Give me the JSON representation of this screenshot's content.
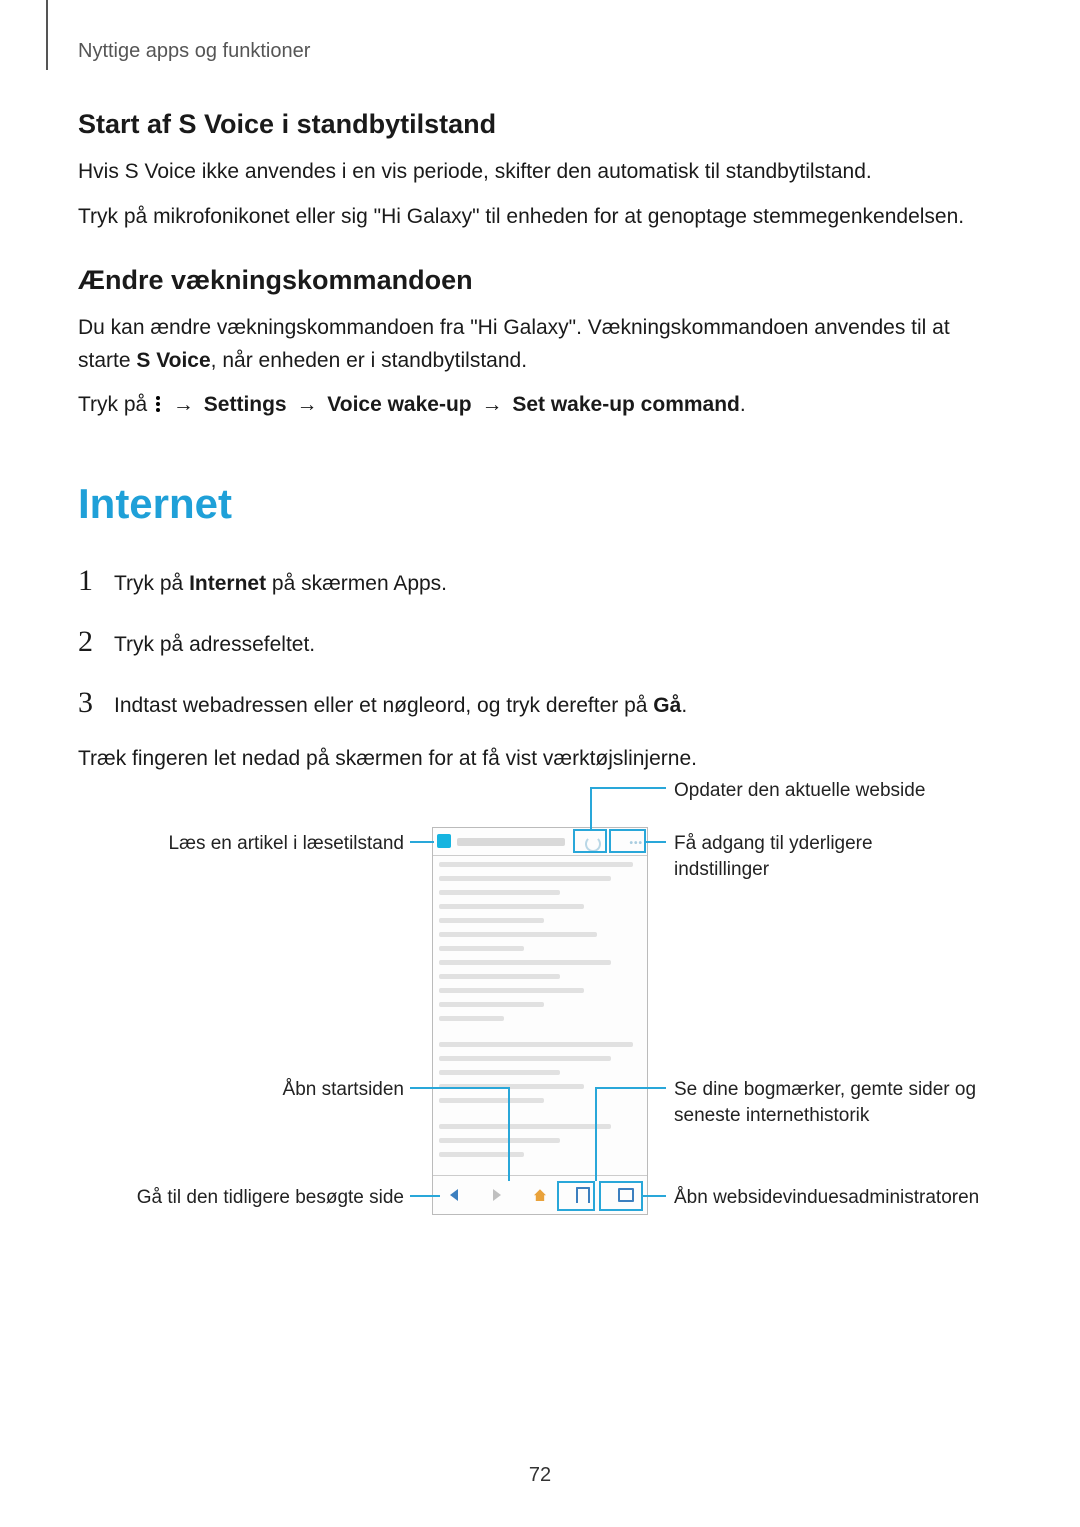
{
  "breadcrumb": "Nyttige apps og funktioner",
  "section_standby": {
    "title": "Start af S Voice i standbytilstand",
    "p1": "Hvis S Voice ikke anvendes i en vis periode, skifter den automatisk til standbytilstand.",
    "p2": "Tryk på mikrofonikonet eller sig \"Hi Galaxy\" til enheden for at genoptage stemmegenkendelsen."
  },
  "section_wake": {
    "title": "Ændre vækningskommandoen",
    "p1_a": "Du kan ændre vækningskommandoen fra \"Hi Galaxy\". Vækningskommandoen anvendes til at starte ",
    "p1_bold": "S Voice",
    "p1_b": ", når enheden er i standbytilstand.",
    "tap_prefix": "Tryk på ",
    "arrow": "→",
    "settings": "Settings",
    "voice_wakeup": "Voice wake-up",
    "set_cmd": "Set wake-up command",
    "period": "."
  },
  "internet": {
    "heading": "Internet",
    "steps": [
      {
        "num": "1",
        "pre": "Tryk på ",
        "bold": "Internet",
        "post": " på skærmen Apps."
      },
      {
        "num": "2",
        "pre": "Tryk på adressefeltet.",
        "bold": "",
        "post": ""
      },
      {
        "num": "3",
        "pre": "Indtast webadressen eller et nøgleord, og tryk derefter på ",
        "bold": "Gå",
        "post": "."
      }
    ],
    "tip": "Træk fingeren let nedad på skærmen for at få vist værktøjslinjerne."
  },
  "callouts": {
    "refresh": "Opdater den aktuelle webside",
    "reader": "Læs en artikel i læsetilstand",
    "more": "Få adgang til yderligere indstillinger",
    "home": "Åbn startsiden",
    "bookmarks": "Se dine bogmærker, gemte sider og seneste internethistorik",
    "back": "Gå til den tidligere besøgte side",
    "tabs": "Åbn websidevinduesadministratoren"
  },
  "page_number": "72"
}
